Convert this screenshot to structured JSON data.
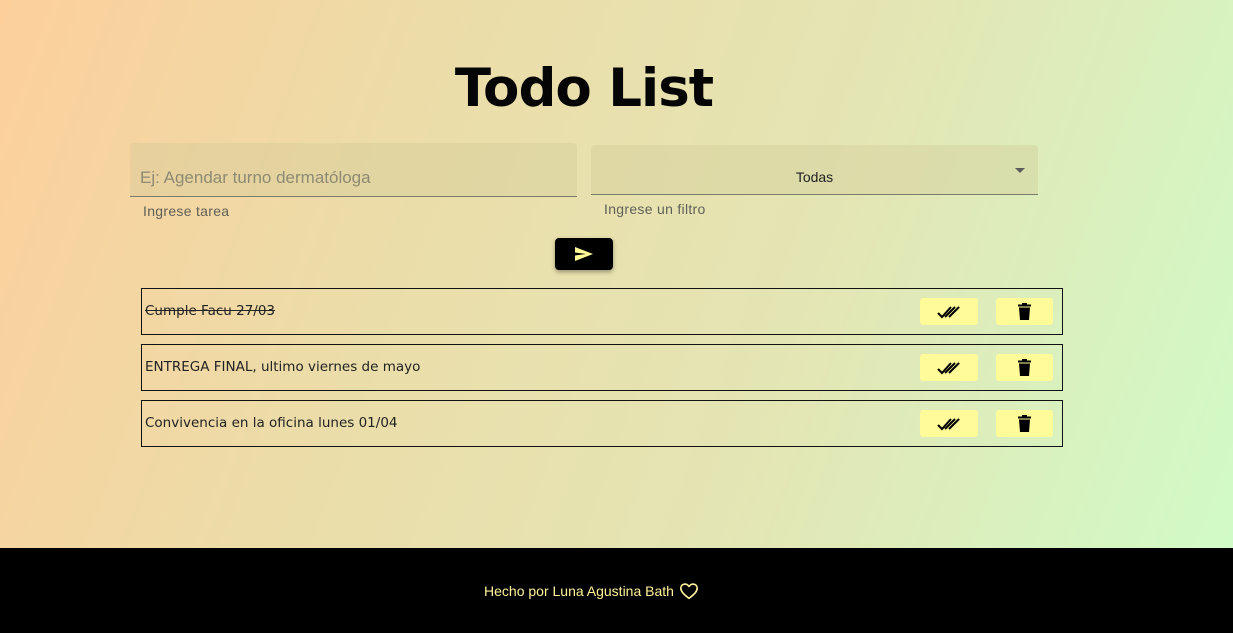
{
  "header": {
    "title": "Todo List"
  },
  "form": {
    "task_input": {
      "value": "",
      "placeholder": "Ej: Agendar turno dermatóloga",
      "helper": "Ingrese tarea"
    },
    "filter_select": {
      "selected": "Todas",
      "helper": "Ingrese un filtro"
    },
    "submit_icon": "send-icon"
  },
  "todos": [
    {
      "text": "Cumple Facu 27/03",
      "completed": true
    },
    {
      "text": "ENTREGA FINAL, ultimo viernes de mayo",
      "completed": false
    },
    {
      "text": "Convivencia en la oficina lunes 01/04",
      "completed": false
    }
  ],
  "actions": {
    "complete_icon": "double-check-icon",
    "delete_icon": "trash-icon"
  },
  "footer": {
    "credit": "Hecho por Luna Agustina Bath",
    "icon": "heart-icon"
  },
  "colors": {
    "accent": "#fffb99",
    "footer_bg": "#000000",
    "footer_text": "#fff29a"
  }
}
